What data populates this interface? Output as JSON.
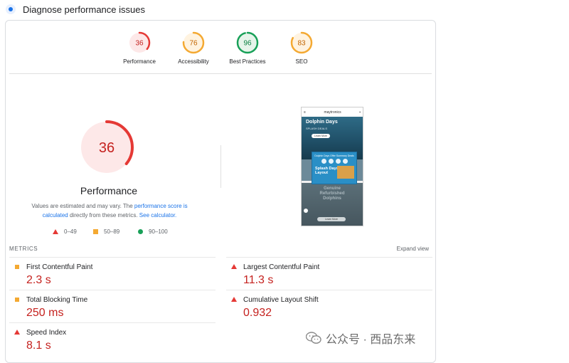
{
  "header": {
    "title": "Diagnose performance issues"
  },
  "scores": [
    {
      "label": "Performance",
      "value": "36",
      "score": 36,
      "color": "#e53935",
      "bg": "#fde8e8",
      "text_color": "#c5221f"
    },
    {
      "label": "Accessibility",
      "value": "76",
      "score": 76,
      "color": "#f4a932",
      "bg": "#fff3e0",
      "text_color": "#c26401"
    },
    {
      "label": "Best Practices",
      "value": "96",
      "score": 96,
      "color": "#18a058",
      "bg": "#e6f4ea",
      "text_color": "#0d8043"
    },
    {
      "label": "SEO",
      "value": "83",
      "score": 83,
      "color": "#f4a932",
      "bg": "#fff3e0",
      "text_color": "#c26401"
    }
  ],
  "performance": {
    "score": "36",
    "title": "Performance",
    "desc_part1": "Values are estimated and may vary. The ",
    "desc_link1": "performance score is calculated",
    "desc_part2": " directly from these metrics. ",
    "desc_link2": "See calculator."
  },
  "legend": {
    "poor": "0–49",
    "average": "50–89",
    "good": "90–100"
  },
  "screenshot": {
    "brand": "maytronics",
    "hero_title": "Dolphin Days",
    "hero_sub": "SPLASH DEALS",
    "hero_btn": "Learn More",
    "popup_title": "Dolphin Days Offer Summary Deals",
    "popup_text": "Splash Days Sales Layout",
    "bottom_text": "Genuine Refurbished Dolphins",
    "bottom_btn": "Learn More"
  },
  "metrics": {
    "header": "METRICS",
    "expand": "Expand view",
    "items": [
      {
        "name": "First Contentful Paint",
        "value": "2.3 s",
        "status": "average"
      },
      {
        "name": "Largest Contentful Paint",
        "value": "11.3 s",
        "status": "poor"
      },
      {
        "name": "Total Blocking Time",
        "value": "250 ms",
        "status": "average"
      },
      {
        "name": "Cumulative Layout Shift",
        "value": "0.932",
        "status": "poor"
      },
      {
        "name": "Speed Index",
        "value": "8.1 s",
        "status": "poor"
      }
    ]
  },
  "watermark": {
    "text": "公众号 · 西品东来"
  }
}
